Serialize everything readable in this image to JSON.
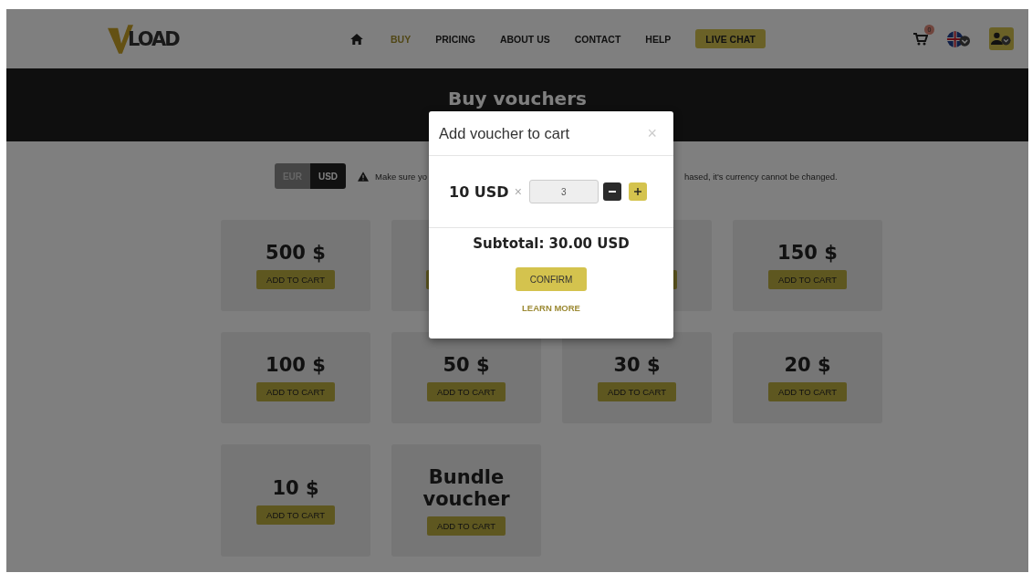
{
  "header": {
    "logo": "LOAD",
    "nav": [
      {
        "label": "BUY",
        "selected": true
      },
      {
        "label": "PRICING",
        "selected": false
      },
      {
        "label": "ABOUT US",
        "selected": false
      },
      {
        "label": "CONTACT",
        "selected": false
      },
      {
        "label": "HELP",
        "selected": false
      }
    ],
    "live_chat": "LIVE CHAT",
    "cart_count": "0"
  },
  "banner": {
    "title": "Buy vouchers"
  },
  "currency": [
    {
      "label": "EUR",
      "selected": false
    },
    {
      "label": "USD",
      "selected": true
    }
  ],
  "notice": {
    "visible_start": "Make sure yo",
    "visible_end": "hased, it's currency cannot be changed."
  },
  "vouchers": [
    {
      "kind": "card",
      "price": "500 $",
      "button": "ADD TO CART"
    },
    {
      "kind": "covered"
    },
    {
      "kind": "covered"
    },
    {
      "kind": "card",
      "price": "150 $",
      "button": "ADD TO CART"
    },
    {
      "kind": "card",
      "price": "100 $",
      "button": "ADD TO CART"
    },
    {
      "kind": "card",
      "price": "50 $",
      "button": "ADD TO CART"
    },
    {
      "kind": "card",
      "price": "30 $",
      "button": "ADD TO CART"
    },
    {
      "kind": "card",
      "price": "20 $",
      "button": "ADD TO CART"
    },
    {
      "kind": "card",
      "price": "10 $",
      "button": "ADD TO CART"
    },
    {
      "kind": "card",
      "price": "Bundle voucher",
      "button": "ADD TO CART"
    }
  ],
  "modal": {
    "title": "Add voucher to cart",
    "close": "×",
    "unit": "10 USD",
    "times": "×",
    "quantity": "3",
    "subtotal": "Subtotal: 30.00 USD",
    "confirm": "CONFIRM",
    "learn_more": "LEARN MORE"
  }
}
